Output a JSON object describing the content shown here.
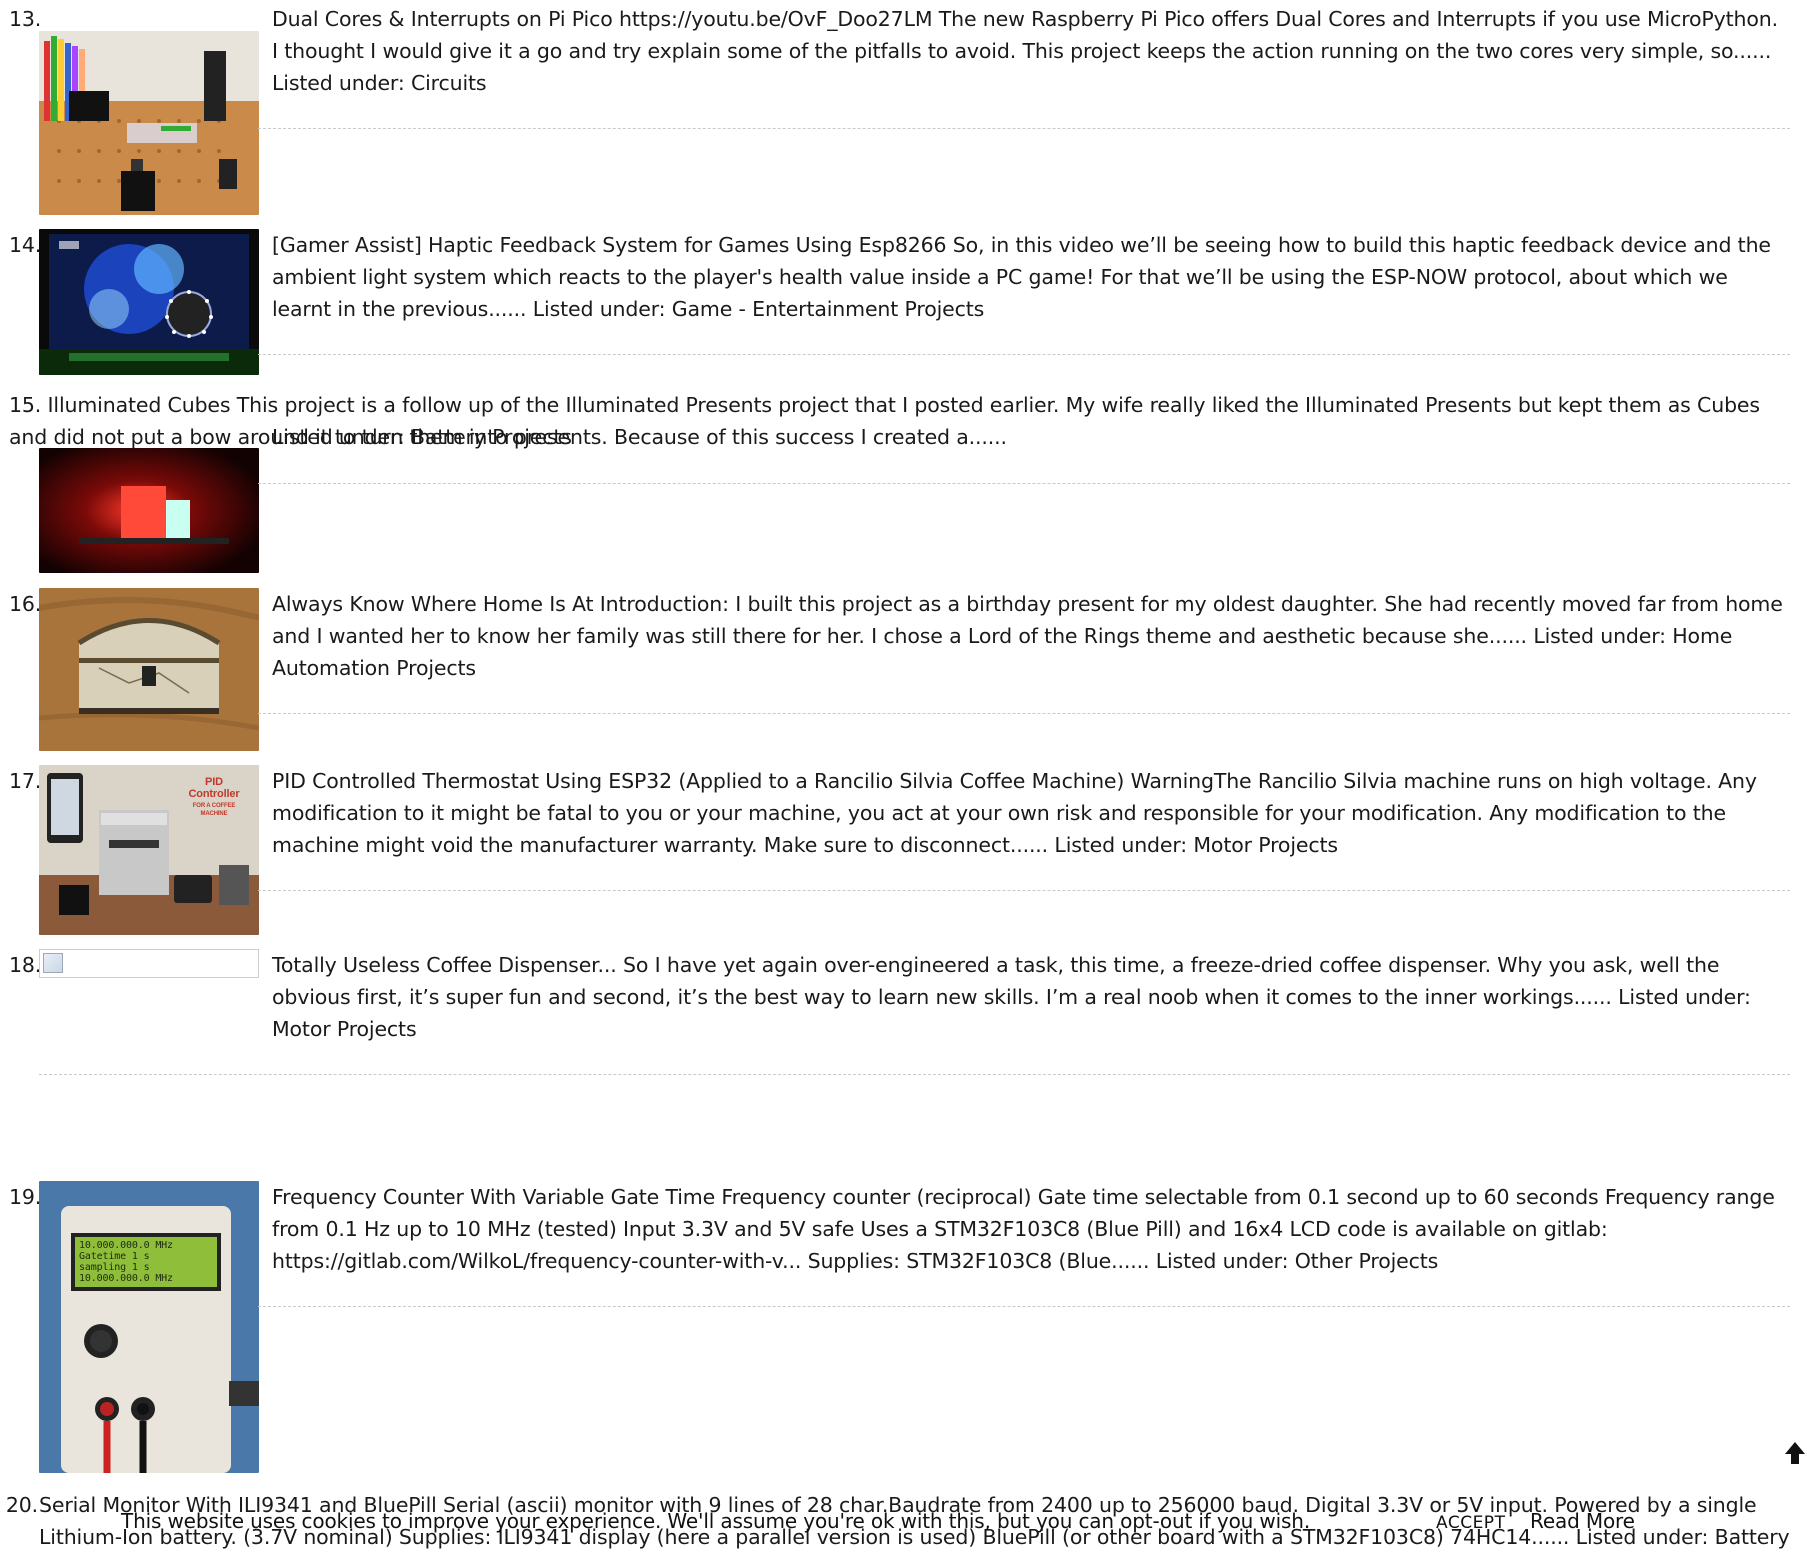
{
  "items": [
    {
      "number": "13.",
      "title": "Dual Cores & Interrupts on Pi Pico",
      "text": "Dual Cores & Interrupts on Pi Pico https://youtu.be/OvF_Doo27LM The new Raspberry Pi Pico offers Dual Cores and Interrupts if you use MicroPython. I thought I would give it a go and try explain some of the pitfalls to avoid. This project keeps the action running on the two cores very simple, so......",
      "listed": "Listed under: Circuits",
      "image_icon": "pi-pico-board-photo"
    },
    {
      "number": "14.",
      "text": "[Gamer Assist] Haptic Feedback System for Games Using Esp8266 So, in this video we’ll be seeing how to build this haptic feedback device and the ambient light system which reacts to the player's health value inside a PC game! For that we’ll be using the ESP-NOW protocol, about which we learnt in the previous......",
      "listed": "Listed under: Game - Entertainment Projects",
      "image_icon": "gaming-monitor-photo"
    },
    {
      "number": "15.",
      "text": "Illuminated Cubes This project is a follow up of the Illuminated Presents project that I posted earlier. My wife really liked the Illuminated Presents but kept them as Cubes and did not put a bow around it to turn them into presents. Because of this success I created a......",
      "listed": "Listed under: Battery Projects",
      "image_icon": "glowing-cubes-photo"
    },
    {
      "number": "16.",
      "text": "Always Know Where Home Is At Introduction: I built this project as a birthday present for my oldest daughter. She had recently moved far from home and I wanted her to know her family was still there for her. I chose a Lord of the Rings theme and aesthetic because she......",
      "listed": "Listed under: Home Automation Projects",
      "image_icon": "treasure-box-photo"
    },
    {
      "number": "17.",
      "text": "PID Controlled Thermostat Using ESP32 (Applied to a Rancilio Silvia Coffee Machine) WarningThe Rancilio Silvia machine runs on high voltage. Any modification to it might be fatal to you or your machine, you act at your own risk and responsible for your modification. Any modification to the machine might void the manufacturer warranty. Make sure to disconnect......",
      "listed": "Listed under: Motor Projects",
      "image_icon": "coffee-machine-photo",
      "image_caption": [
        "PID",
        "Controller",
        "FOR A COFFEE",
        "MACHINE"
      ]
    },
    {
      "number": "18.",
      "text": "Totally Useless Coffee Dispenser... So I have yet again over-engineered a task, this time, a freeze-dried coffee dispenser. Why you ask, well the obvious first, it’s super fun and second, it’s the best way to learn new skills. I’m a real noob when it comes to the inner workings......",
      "listed": "Listed under: Motor Projects",
      "image_icon": "broken-image-icon"
    },
    {
      "number": "19.",
      "text": "Frequency Counter With Variable Gate Time Frequency counter (reciprocal) Gate time selectable from 0.1 second up to 60 seconds Frequency range from 0.1 Hz up to 10 MHz (tested) Input 3.3V and 5V safe Uses a STM32F103C8 (Blue Pill) and 16x4 LCD code is available on gitlab: https://gitlab.com/WilkoL/frequency-counter-with-v... Supplies: STM32F103C8 (Blue......",
      "listed": "Listed under: Other Projects",
      "image_icon": "frequency-counter-photo",
      "lcd_lines": [
        "10.000.000.0 MHz",
        "Gatetime    1 s",
        "sampling    1 s",
        "10.000.000.0 MHz"
      ]
    },
    {
      "number": "20.",
      "text": "Serial Monitor With ILI9341 and BluePill Serial (ascii) monitor with 9 lines of 28 char.Baudrate from 2400 up to 256000 baud. Digital 3.3V or 5V input. Powered by a single Lithium-Ion battery. (3.7V nominal) Supplies: ILI9341 display (here a parallel version is used) BluePill (or other board with a STM32F103C8) 74HC14......",
      "listed": "Listed under: Battery"
    }
  ],
  "cookie_bar": {
    "message": "This website uses cookies to improve your experience. We'll assume you're ok with this, but you can opt-out if you wish.",
    "accept_label": "ACCEPT",
    "read_more_label": "Read More"
  },
  "back_to_top_icon": "arrow-up-icon"
}
